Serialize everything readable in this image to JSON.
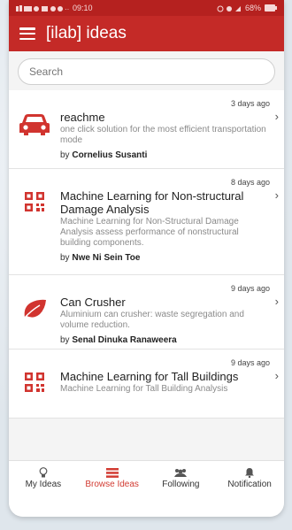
{
  "status_bar": {
    "time": "09:10",
    "battery": "68%"
  },
  "app_bar": {
    "title": "[ilab] ideas"
  },
  "search": {
    "placeholder": "Search"
  },
  "ideas": [
    {
      "time": "3 days ago",
      "title": "reachme",
      "description": "one click solution for the most efficient transportation mode",
      "author_prefix": "by",
      "author": "Cornelius Susanti",
      "icon": "car-icon"
    },
    {
      "time": "8 days ago",
      "title": "Machine Learning for Non-structural Damage Analysis",
      "description": "Machine Learning for Non-Structural Damage Analysis assess performance of nonstructural building components.",
      "author_prefix": "by",
      "author": "Nwe Ni Sein Toe",
      "icon": "qr-code-icon"
    },
    {
      "time": "9 days ago",
      "title": "Can Crusher",
      "description": "Aluminium can crusher: waste segregation and volume reduction.",
      "author_prefix": "by",
      "author": "Senal Dinuka Ranaweera",
      "icon": "leaf-icon"
    },
    {
      "time": "9 days ago",
      "title": "Machine Learning for Tall Buildings",
      "description": "Machine Learning for Tall Building Analysis",
      "author_prefix": "",
      "author": "",
      "icon": "qr-code-icon"
    }
  ],
  "bottom_nav": [
    {
      "label": "My Ideas",
      "icon": "lightbulb-icon"
    },
    {
      "label": "Browse Ideas",
      "icon": "list-icon"
    },
    {
      "label": "Following",
      "icon": "group-icon"
    },
    {
      "label": "Notification",
      "icon": "bell-icon"
    }
  ],
  "colors": {
    "primary": "#c42a27",
    "active_nav": "#d23b32"
  }
}
